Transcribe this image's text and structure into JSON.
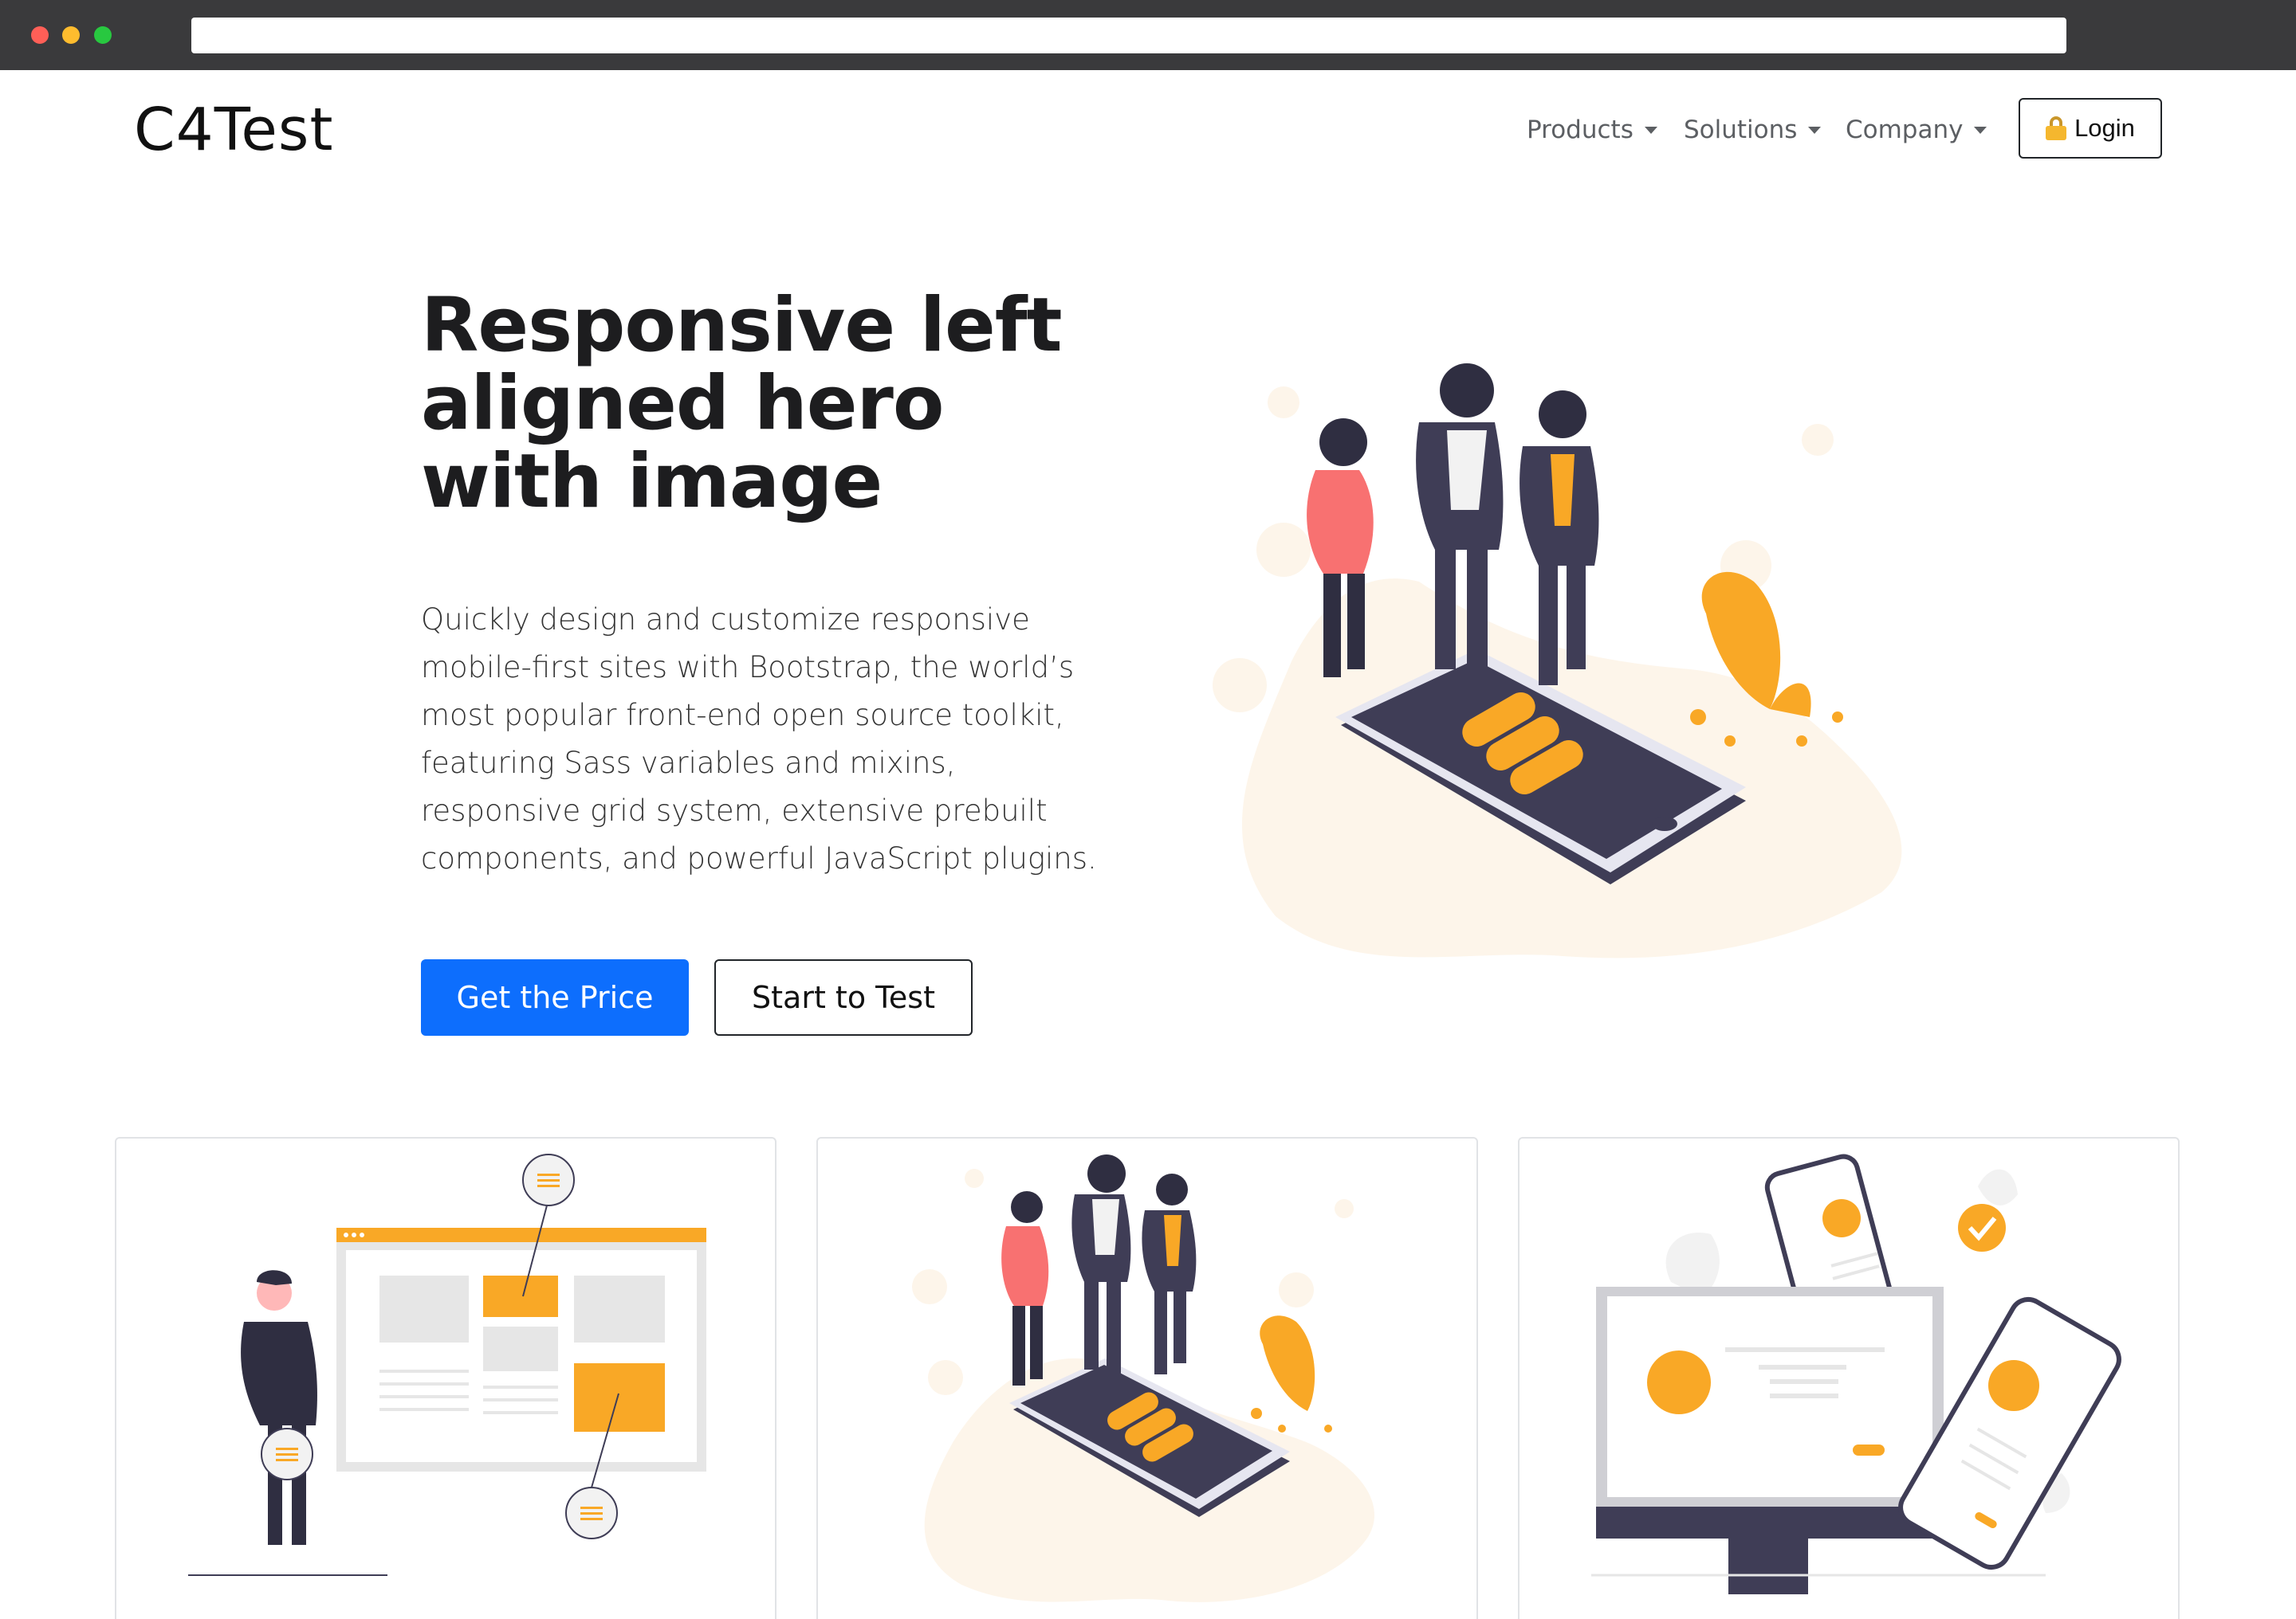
{
  "brand": {
    "name": "C4Test"
  },
  "nav": {
    "items": [
      {
        "label": "Products"
      },
      {
        "label": "Solutions"
      },
      {
        "label": "Company"
      }
    ],
    "login_label": "Login"
  },
  "hero": {
    "title": "Responsive left aligned hero with image",
    "text": "Quickly design and customize responsive mobile-first sites with Bootstrap, the world’s most popular front-end open source toolkit, featuring Sass variables and mixins, responsive grid system, extensive prebuilt components, and powerful JavaScript plugins.",
    "primary_button": "Get the Price",
    "secondary_button": "Start to Test"
  },
  "colors": {
    "primary": "#0d6efd",
    "accent": "#f9a826",
    "dark": "#3f3d56",
    "blob": "#fdf5ea"
  },
  "icons": [
    "lock-icon",
    "chevron-down-icon"
  ]
}
